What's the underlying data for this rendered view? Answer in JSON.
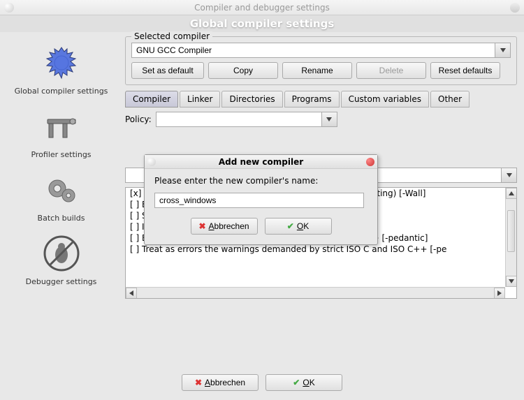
{
  "window": {
    "title": "Compiler and debugger settings",
    "banner": "Global compiler settings"
  },
  "sidebar": {
    "items": [
      {
        "label": "Global compiler settings"
      },
      {
        "label": "Profiler settings"
      },
      {
        "label": "Batch builds"
      },
      {
        "label": "Debugger settings"
      }
    ]
  },
  "compiler_group": {
    "legend": "Selected compiler",
    "value": "GNU GCC Compiler",
    "buttons": {
      "set_default": "Set as default",
      "copy": "Copy",
      "rename": "Rename",
      "delete": "Delete",
      "reset": "Reset defaults"
    }
  },
  "tabs": {
    "items": [
      "Compiler",
      "Linker",
      "Directories",
      "Programs",
      "Custom variables",
      "Other"
    ],
    "active": 0
  },
  "policy": {
    "label": "Policy:",
    "value": ""
  },
  "options": [
    "[x] Enable all compiler warnings (overrides every other setting)  [-Wall]",
    "[ ] Enable standard compiler warnings  [-W]",
    "[ ] Stop compiling after first error  [-Wfatal-errors]",
    "[ ] Inhibit all warning messages  [-w]",
    "[ ] Enable warnings demanded by strict ISO C and ISO C++  [-pedantic]",
    "[ ] Treat as errors the warnings demanded by strict ISO C and ISO C++  [-pe"
  ],
  "bottom": {
    "cancel": "Abbrechen",
    "ok": "OK"
  },
  "modal": {
    "title": "Add new compiler",
    "prompt": "Please enter the new compiler's name:",
    "value": "cross_windows",
    "cancel": "Abbrechen",
    "ok": "OK"
  }
}
